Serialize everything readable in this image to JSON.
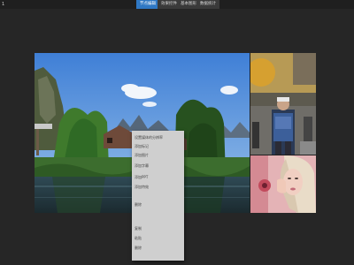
{
  "app": {
    "top_left_label": "1"
  },
  "tabs": [
    {
      "label": "节点编辑",
      "active": true
    },
    {
      "label": "效果控件",
      "active": false
    },
    {
      "label": "基本图形",
      "active": false
    },
    {
      "label": "数据统计",
      "active": false
    }
  ],
  "context_menu": {
    "items": [
      "设置媒体的分辨率",
      "添加标记",
      "添加图片",
      "添加字幕",
      "添加PPT",
      "添加特效",
      "删除",
      "复制",
      "粘贴",
      "删除"
    ]
  },
  "canvas": {
    "images": [
      {
        "name": "landscape-photo",
        "description_icon": "river-mountain-image"
      },
      {
        "name": "person-backpack-photo",
        "description_icon": "person-image"
      },
      {
        "name": "portrait-photo",
        "description_icon": "portrait-image"
      }
    ]
  },
  "colors": {
    "accent": "#2f78c4",
    "background": "#262626",
    "menu_bg": "#cfcfcf"
  }
}
